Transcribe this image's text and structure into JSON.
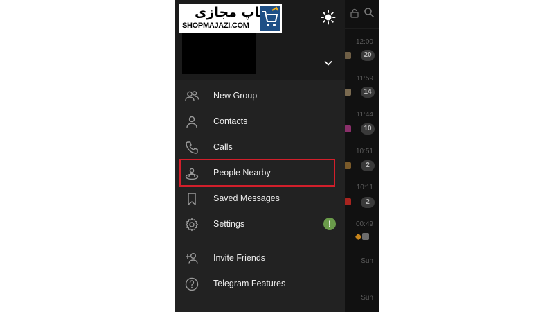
{
  "brand": {
    "logo_text_fa": "شاپ مجازی",
    "logo_text_en": "SHOPMAJAZI.COM",
    "logo_icon": "shopping-cart-icon",
    "logo_color": "#1e4f86"
  },
  "drawer": {
    "theme_toggle_icon": "sun-icon",
    "account_toggle_icon": "chevron-down-icon",
    "menu": [
      {
        "label": "New Group",
        "icon": "group-icon"
      },
      {
        "label": "Contacts",
        "icon": "person-icon"
      },
      {
        "label": "Calls",
        "icon": "phone-icon"
      },
      {
        "label": "People Nearby",
        "icon": "people-nearby-icon",
        "highlighted": true
      },
      {
        "label": "Saved Messages",
        "icon": "bookmark-icon"
      },
      {
        "label": "Settings",
        "icon": "gear-icon",
        "badge": "!"
      }
    ],
    "secondary_menu": [
      {
        "label": "Invite Friends",
        "icon": "add-person-icon"
      },
      {
        "label": "Telegram Features",
        "icon": "question-icon"
      }
    ]
  },
  "chat_list": {
    "items": [
      {
        "time": "12:00",
        "badge": "20"
      },
      {
        "time": "11:59",
        "badge": "14"
      },
      {
        "time": "11:44",
        "badge": "10"
      },
      {
        "time": "10:51",
        "badge": "2"
      },
      {
        "time": "10:11",
        "badge": "2"
      },
      {
        "time": "00:49",
        "badge": ""
      },
      {
        "time": "Sun",
        "badge": ""
      },
      {
        "time": "Sun",
        "badge": ""
      }
    ]
  },
  "colors": {
    "drawer_bg": "#222222",
    "header_bg": "#1b1b1b",
    "highlight_border": "#d21f2b",
    "settings_badge": "#6a9b4a"
  }
}
